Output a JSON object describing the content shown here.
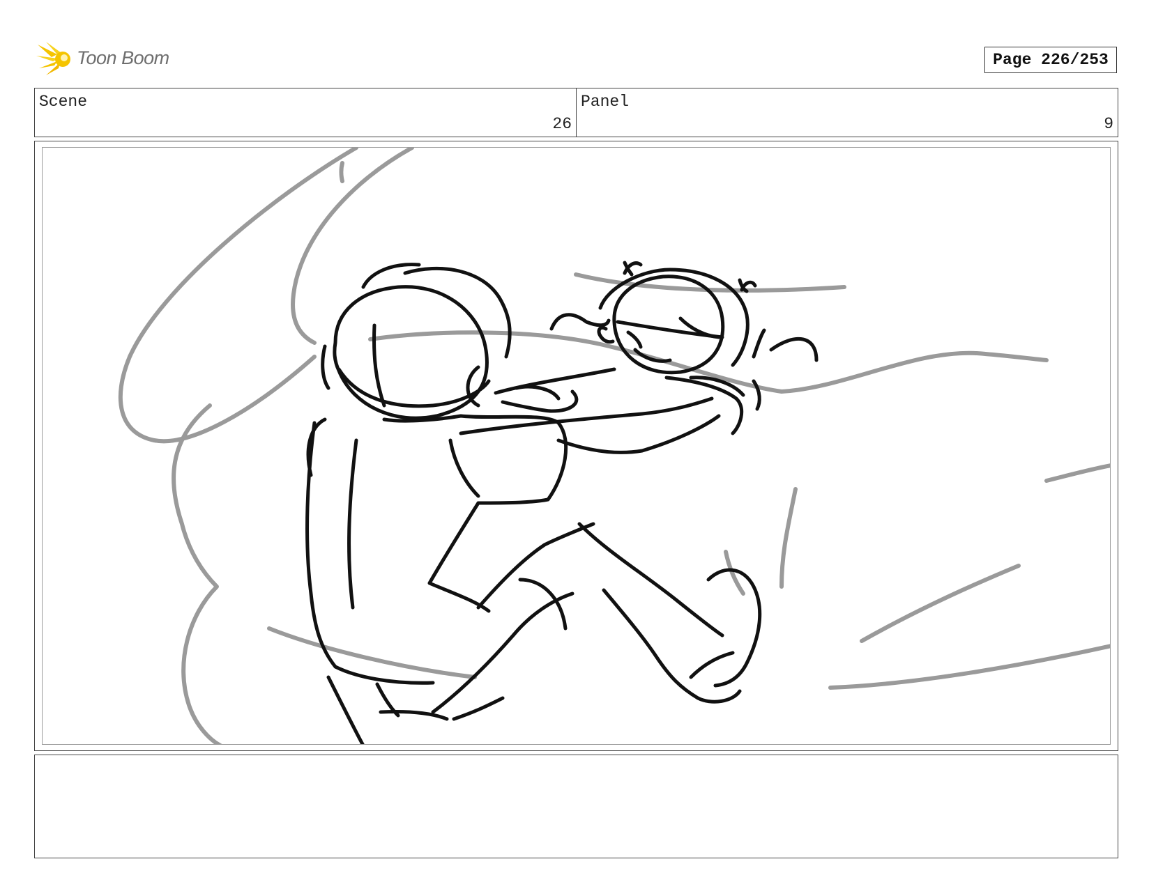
{
  "header": {
    "logo_text": "Toon Boom",
    "page_label": "Page 226/253"
  },
  "fields": {
    "scene_label": "Scene",
    "scene_value": "26",
    "panel_label": "Panel",
    "panel_value": "9"
  },
  "colors": {
    "logo_accent": "#f5c400",
    "sketch_line": "#111111",
    "sketch_background_line": "#9a9a9a"
  },
  "notes": {
    "text": ""
  }
}
